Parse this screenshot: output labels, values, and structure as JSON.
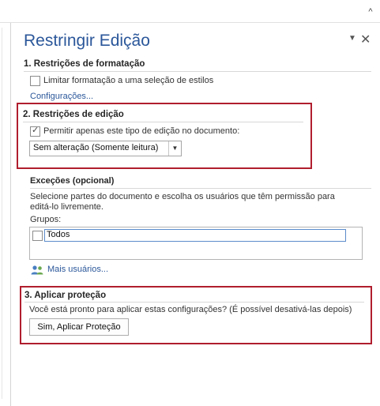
{
  "pane": {
    "title": "Restringir Edição",
    "menu_glyph": "▼",
    "close_glyph": "✕",
    "scroll_up_glyph": "^"
  },
  "formatting": {
    "heading": "1. Restrições de formatação",
    "checkbox_label": "Limitar formatação a uma seleção de estilos",
    "checked": false,
    "settings_link": "Configurações..."
  },
  "editing": {
    "heading": "2. Restrições de edição",
    "checkbox_label": "Permitir apenas este tipo de edição no documento:",
    "checked": true,
    "checkmark": "✓",
    "dropdown_value": "Sem alteração (Somente leitura)",
    "dropdown_arrow": "▼"
  },
  "exceptions": {
    "heading": "Exceções (opcional)",
    "description_line1": "Selecione partes do documento e escolha os usuários que têm permissão para",
    "description_line2": "editá-lo livremente.",
    "groups_label": "Grupos:",
    "groups": [
      {
        "name": "Todos",
        "checked": false
      }
    ],
    "more_users_link": "Mais usuários..."
  },
  "protection": {
    "heading": "3. Aplicar proteção",
    "prompt": "Você está pronto para aplicar estas configurações? (É possível desativá-las depois)",
    "apply_button": "Sim, Aplicar Proteção"
  },
  "colors": {
    "title_blue": "#2b579a",
    "highlight_red": "#b01e2e",
    "link_blue": "#2b579a"
  },
  "icons": {
    "users": "users-icon",
    "menu": "chevron-down-icon",
    "close": "close-icon"
  }
}
